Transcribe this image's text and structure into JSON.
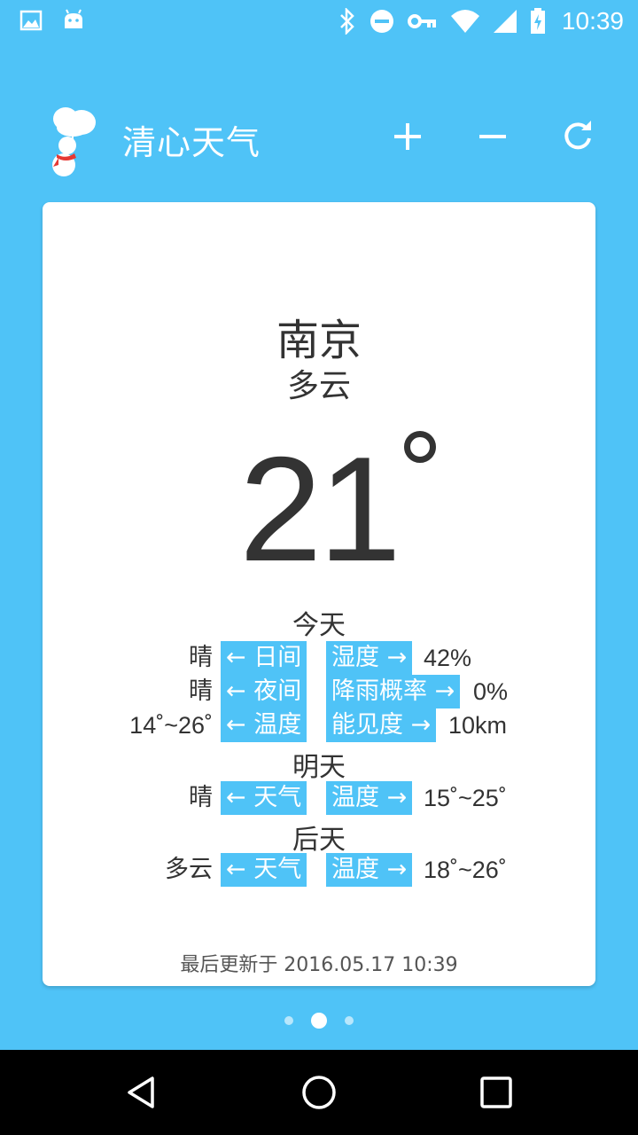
{
  "status_bar": {
    "time": "10:39",
    "left_icons": [
      "image-icon",
      "android-icon"
    ],
    "right_icons": [
      "bluetooth-icon",
      "do-not-disturb-icon",
      "vpn-key-icon",
      "wifi-icon",
      "cell-signal-icon",
      "battery-charging-icon"
    ]
  },
  "app_bar": {
    "title": "清心天气",
    "actions": [
      "add-icon",
      "remove-icon",
      "refresh-icon"
    ]
  },
  "card": {
    "city": "南京",
    "condition": "多云",
    "temperature": "21",
    "today": {
      "title": "今天",
      "rows": [
        {
          "left_value": "晴",
          "left_tag": "← 日间",
          "right_tag": "湿度 →",
          "right_value": "42%"
        },
        {
          "left_value": "晴",
          "left_tag": "← 夜间",
          "right_tag": "降雨概率 →",
          "right_value": "0%"
        },
        {
          "left_value": "14˚~26˚",
          "left_tag": "← 温度",
          "right_tag": "能见度 →",
          "right_value": "10km"
        }
      ]
    },
    "tomorrow": {
      "title": "明天",
      "row": {
        "left_value": "晴",
        "left_tag": "← 天气",
        "right_tag": "温度 →",
        "right_value": "15˚~25˚"
      }
    },
    "day_after": {
      "title": "后天",
      "row": {
        "left_value": "多云",
        "left_tag": "← 天气",
        "right_tag": "温度 →",
        "right_value": "18˚~26˚"
      }
    },
    "last_updated": "最后更新于 2016.05.17 10:39"
  },
  "pager": {
    "count": 3,
    "active_index": 1
  },
  "colors": {
    "primary": "#4fc3f7",
    "card": "#ffffff",
    "text": "#333333"
  }
}
